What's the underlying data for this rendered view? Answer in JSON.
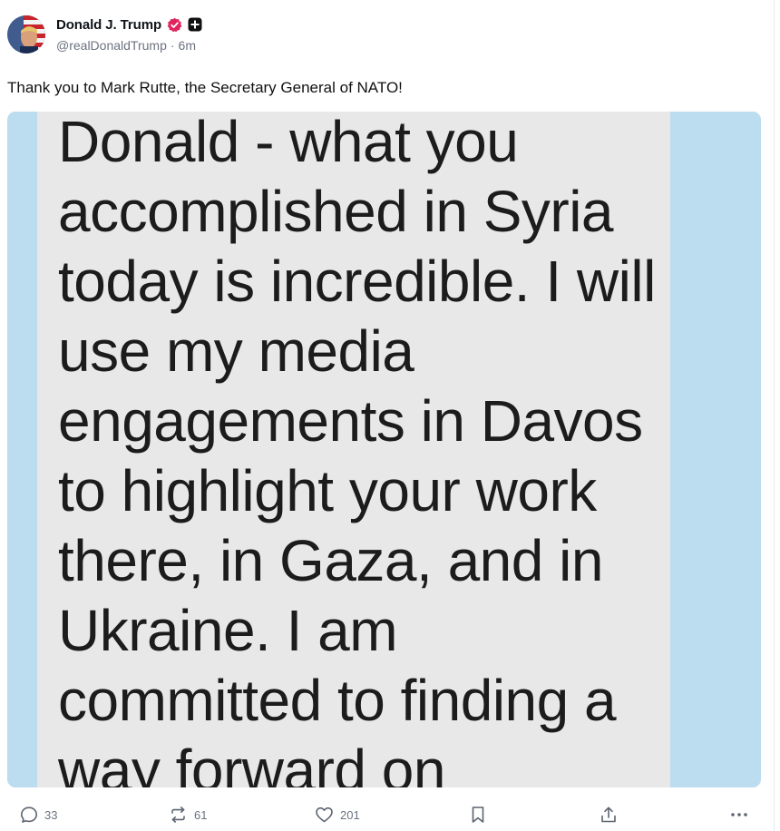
{
  "author": {
    "display_name": "Donald J. Trump",
    "handle": "@realDonaldTrump",
    "separator": "·",
    "timestamp": "6m",
    "verified_badge_color": "#e0245e"
  },
  "post": {
    "text": "Thank you to Mark Rutte, the Secretary General of NATO!"
  },
  "media": {
    "message_lines": [
      "Donald - what you",
      "accomplished in Syria",
      "today is incredible. I will",
      "use my media",
      "engagements in Davos",
      "to highlight your work",
      "there, in Gaza, and in",
      "Ukraine. I am",
      "committed to finding a",
      "way forward on"
    ],
    "background_color": "#bcdcef",
    "bubble_color": "#e8e8e8"
  },
  "actions": {
    "replies": "33",
    "reposts": "61",
    "likes": "201"
  },
  "icons": {
    "reply": "reply-icon",
    "repost": "repost-icon",
    "like": "heart-icon",
    "bookmark": "bookmark-icon",
    "share": "share-icon",
    "more": "more-icon"
  }
}
